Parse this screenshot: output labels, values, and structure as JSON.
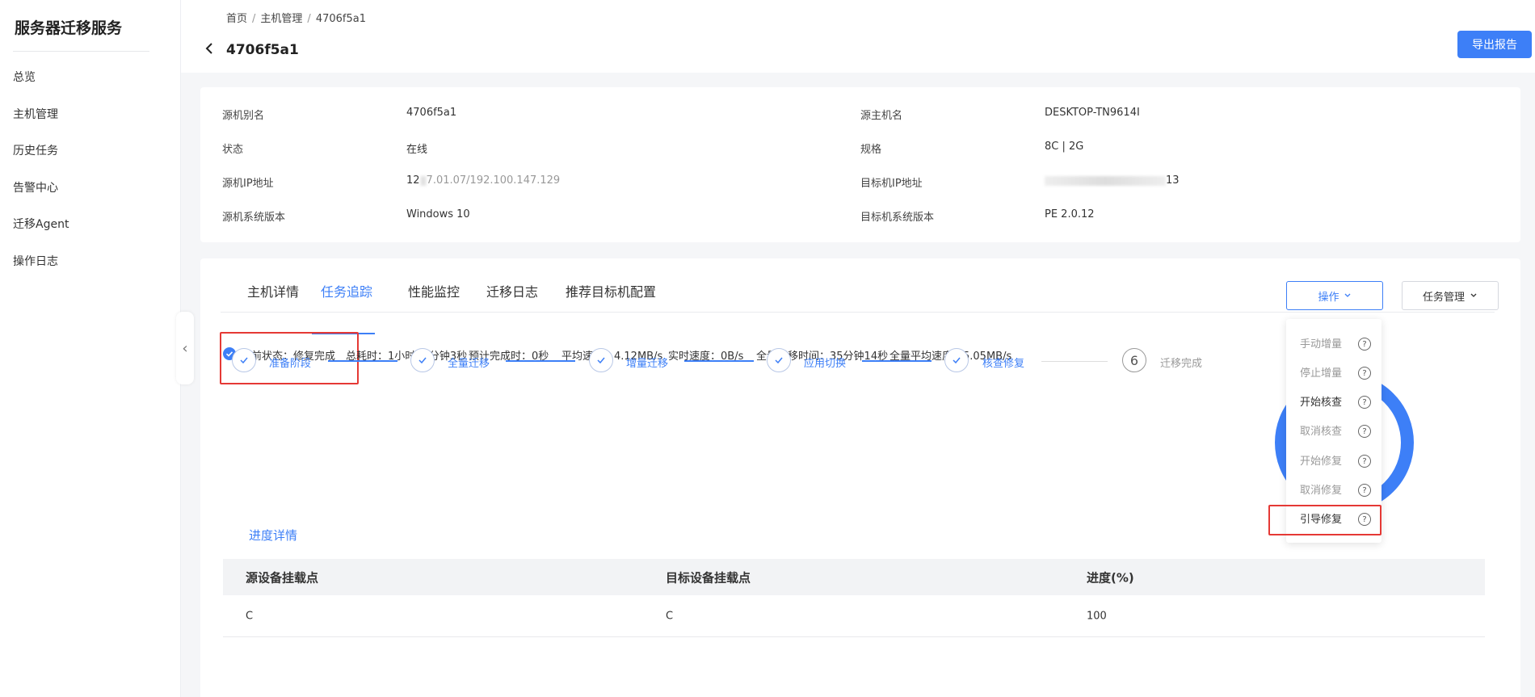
{
  "sidebar": {
    "title": "服务器迁移服务",
    "items": [
      {
        "label": "总览"
      },
      {
        "label": "主机管理"
      },
      {
        "label": "历史任务"
      },
      {
        "label": "告警中心"
      },
      {
        "label": "迁移Agent"
      },
      {
        "label": "操作日志"
      }
    ]
  },
  "header": {
    "breadcrumb": [
      "首页",
      "主机管理",
      "4706f5a1"
    ],
    "title": "4706f5a1",
    "export_label": "导出报告"
  },
  "info": {
    "left": [
      {
        "label": "源机别名",
        "value": "4706f5a1"
      },
      {
        "label": "状态",
        "value": "在线"
      },
      {
        "label": "源机IP地址",
        "value_prefix": "12",
        "value_suffix": "7.01.07/192.100.147.129"
      },
      {
        "label": "源机系统版本",
        "value": "Windows 10"
      }
    ],
    "right": [
      {
        "label": "源主机名",
        "value": "DESKTOP-TN9614I"
      },
      {
        "label": "规格",
        "value": "8C | 2G"
      },
      {
        "label": "目标机IP地址",
        "value_suffix": "13"
      },
      {
        "label": "目标机系统版本",
        "value": "PE 2.0.12"
      }
    ]
  },
  "tabs": [
    {
      "label": "主机详情"
    },
    {
      "label": "任务追踪"
    },
    {
      "label": "性能监控"
    },
    {
      "label": "迁移日志"
    },
    {
      "label": "推荐目标机配置"
    }
  ],
  "buttons": {
    "operation": "操作",
    "task_manage": "任务管理"
  },
  "status": {
    "current": "当前状态：修复完成",
    "elapsed": "总耗时：1小时27分钟3秒",
    "eta": "预计完成时：0秒",
    "avg_speed": "平均速度：4.12MB/s",
    "realtime_speed": "实时速度：0B/s",
    "full_time": "全量迁移时间：35分钟14秒",
    "full_avg_speed": "全量平均速度：5.05MB/s"
  },
  "steps": [
    {
      "label": "准备阶段",
      "done": true
    },
    {
      "label": "全量迁移",
      "done": true
    },
    {
      "label": "增量迁移",
      "done": true
    },
    {
      "label": "应用切换",
      "done": true
    },
    {
      "label": "核查修复",
      "done": true
    },
    {
      "label": "迁移完成",
      "done": false,
      "number": "6"
    }
  ],
  "progress_tab": "进度详情",
  "table": {
    "headers": [
      "源设备挂载点",
      "目标设备挂载点",
      "进度(%)"
    ],
    "rows": [
      [
        "C",
        "C",
        "100"
      ]
    ]
  },
  "menu": {
    "items": [
      {
        "label": "手动增量",
        "enabled": false
      },
      {
        "label": "停止增量",
        "enabled": false
      },
      {
        "label": "开始核查",
        "enabled": true
      },
      {
        "label": "取消核查",
        "enabled": false
      },
      {
        "label": "开始修复",
        "enabled": false
      },
      {
        "label": "取消修复",
        "enabled": false
      },
      {
        "label": "引导修复",
        "enabled": true
      }
    ],
    "help_glyph": "?"
  },
  "colors": {
    "accent": "#3d7ff7",
    "highlight": "#e53935"
  }
}
